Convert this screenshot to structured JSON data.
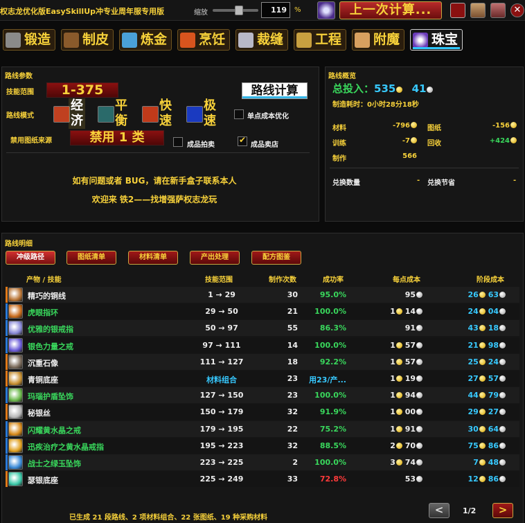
{
  "app": {
    "title": "权志龙优化版EasySkillUp冲专业周年服专用版",
    "zoom_label": "缩放",
    "zoom_value": "119",
    "zoom_unit": "%",
    "last_calc": "上一次计算..."
  },
  "professions": [
    {
      "label": "锻造",
      "color": "#8a8a8a"
    },
    {
      "label": "制皮",
      "color": "#8a5a2b"
    },
    {
      "label": "炼金",
      "color": "#4aa0d8"
    },
    {
      "label": "烹饪",
      "color": "#d8541e"
    },
    {
      "label": "裁缝",
      "color": "#b8b8c8"
    },
    {
      "label": "工程",
      "color": "#c8a040"
    },
    {
      "label": "附魔",
      "color": "#d8a060"
    },
    {
      "label": "珠宝",
      "color": "#8a5ad8"
    }
  ],
  "params": {
    "title": "路线参数",
    "skill_range_label": "技能范围",
    "skill_range_value": "1-375",
    "calc_button": "路线计算",
    "mode_label": "路线模式",
    "modes": [
      {
        "text": "经济",
        "active": true
      },
      {
        "text": "平衡",
        "active": false
      },
      {
        "text": "快速",
        "active": false
      },
      {
        "text": "极速",
        "active": false
      }
    ],
    "single_cost_label": "单点成本优化",
    "ban_source_label": "禁用图纸来源",
    "ban_source_value": "禁用 1 类",
    "auction_label": "成品拍卖",
    "vendor_label": "成品卖店",
    "info_line1": "如有问题或者 BUG，请在新手盒子联系本人",
    "info_line2": "欢迎来 铁2——找增强萨权志龙玩"
  },
  "overview": {
    "title": "路线概览",
    "total_label": "总投入：",
    "total_gold": "535",
    "total_silver": "41",
    "time_label": "制造耗时：",
    "time_value": "0小时28分18秒",
    "materials_label": "材料",
    "materials_value": "-796",
    "patterns_label": "图纸",
    "patterns_value": "-156",
    "training_label": "训练",
    "training_value": "-7",
    "recycle_label": "回收",
    "recycle_value": "+424",
    "craft_label": "制作",
    "craft_value": "566",
    "exchange_qty_label": "兑换数量",
    "exchange_qty_value": "-",
    "exchange_save_label": "兑换节省",
    "exchange_save_value": "-"
  },
  "details": {
    "title": "路线明细",
    "tabs": [
      "冲级路径",
      "图纸清单",
      "材料清单",
      "产出处理",
      "配方图鉴"
    ],
    "headers": {
      "product": "产物 / 技能",
      "range": "技能范围",
      "count": "制作次数",
      "rate": "成功率",
      "unit_cost": "每点成本",
      "stage_cost": "阶段成本"
    },
    "rows": [
      {
        "name": "精巧的铜线",
        "name_color": "#eeeeee",
        "range": "1 → 29",
        "count": "30",
        "rate": "95.0%",
        "rate_color": "#39d75c",
        "uc_gold": "",
        "uc_silver": "95",
        "sc_gold": "26",
        "sc_silver": "63",
        "icon": "#b87333"
      },
      {
        "name": "虎眼指环",
        "name_color": "#39d75c",
        "range": "29 → 50",
        "count": "21",
        "rate": "100.0%",
        "rate_color": "#39d75c",
        "uc_gold": "1",
        "uc_silver": "14",
        "sc_gold": "24",
        "sc_silver": "04",
        "icon": "#c86a1a"
      },
      {
        "name": "优雅的银戒指",
        "name_color": "#39d75c",
        "range": "50 → 97",
        "count": "55",
        "rate": "86.3%",
        "rate_color": "#39d75c",
        "uc_gold": "",
        "uc_silver": "91",
        "sc_gold": "43",
        "sc_silver": "18",
        "icon": "#8a8ad8"
      },
      {
        "name": "银色力量之戒",
        "name_color": "#39d75c",
        "range": "97 → 111",
        "count": "14",
        "rate": "100.0%",
        "rate_color": "#39d75c",
        "uc_gold": "1",
        "uc_silver": "57",
        "sc_gold": "21",
        "sc_silver": "98",
        "icon": "#6a5ad8"
      },
      {
        "name": "沉重石像",
        "name_color": "#eeeeee",
        "range": "111 → 127",
        "count": "18",
        "rate": "92.2%",
        "rate_color": "#39d75c",
        "uc_gold": "1",
        "uc_silver": "57",
        "sc_gold": "25",
        "sc_silver": "24",
        "icon": "#7a6a5a"
      },
      {
        "name": "青铜底座",
        "name_color": "#eeeeee",
        "range": "材料组合",
        "count": "23",
        "rate": "用23/产...",
        "rate_color": "#37c9ff",
        "uc_gold": "1",
        "uc_silver": "19",
        "sc_gold": "27",
        "sc_silver": "57",
        "icon": "#c89030"
      },
      {
        "name": "玛瑙护盾坠饰",
        "name_color": "#39d75c",
        "range": "127 → 150",
        "count": "23",
        "rate": "100.0%",
        "rate_color": "#39d75c",
        "uc_gold": "1",
        "uc_silver": "94",
        "sc_gold": "44",
        "sc_silver": "79",
        "icon": "#6ab84a"
      },
      {
        "name": "秘银丝",
        "name_color": "#eeeeee",
        "range": "150 → 179",
        "count": "32",
        "rate": "91.9%",
        "rate_color": "#39d75c",
        "uc_gold": "1",
        "uc_silver": "00",
        "sc_gold": "29",
        "sc_silver": "27",
        "icon": "#b8b8b8"
      },
      {
        "name": "闪耀黄水晶之戒",
        "name_color": "#39d75c",
        "range": "179 → 195",
        "count": "22",
        "rate": "75.2%",
        "rate_color": "#39d75c",
        "uc_gold": "1",
        "uc_silver": "91",
        "sc_gold": "30",
        "sc_silver": "64",
        "icon": "#d88a1a"
      },
      {
        "name": "迅疾治疗之黄水晶戒指",
        "name_color": "#39d75c",
        "range": "195 → 223",
        "count": "32",
        "rate": "88.5%",
        "rate_color": "#39d75c",
        "uc_gold": "2",
        "uc_silver": "70",
        "sc_gold": "75",
        "sc_silver": "86",
        "icon": "#e0a020"
      },
      {
        "name": "战士之绿玉坠饰",
        "name_color": "#39d75c",
        "range": "223 → 225",
        "count": "2",
        "rate": "100.0%",
        "rate_color": "#39d75c",
        "uc_gold": "3",
        "uc_silver": "74",
        "sc_gold": "7",
        "sc_silver": "48",
        "icon": "#3a8ad8"
      },
      {
        "name": "瑟银底座",
        "name_color": "#eeeeee",
        "range": "225 → 249",
        "count": "33",
        "rate": "72.8%",
        "rate_color": "#ff3a3a",
        "uc_gold": "",
        "uc_silver": "53",
        "sc_gold": "12",
        "sc_silver": "86",
        "icon": "#3ac8a8"
      }
    ],
    "footer": "已生成 21 段路线、2 项材料组合、22 张图纸、19 种采购材料",
    "page": "1/2",
    "prev": "<",
    "next": ">"
  },
  "colors": {
    "accent_gold": "#f7d13a",
    "accent_cyan": "#37c9ff",
    "accent_green": "#39d75c",
    "button_red": "#8a1010"
  }
}
